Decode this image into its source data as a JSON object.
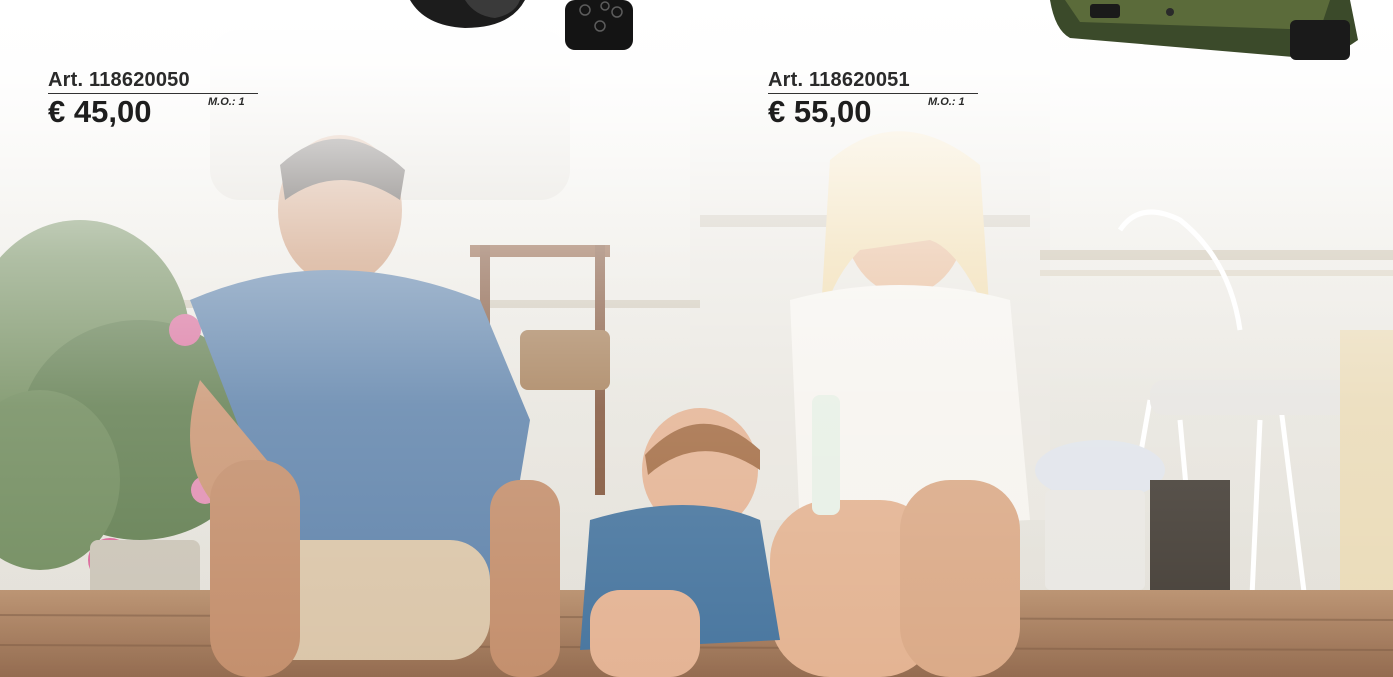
{
  "products": [
    {
      "article": "Art. 118620050",
      "price": "€ 45,00",
      "min_order": "M.O.: 1"
    },
    {
      "article": "Art. 118620051",
      "price": "€ 55,00",
      "min_order": "M.O.: 1"
    }
  ],
  "colors": {
    "text": "#2a2a2a",
    "background": "#f5f4f1",
    "product_dark": "#1c1c1c",
    "product_green": "#5b6b3a"
  }
}
